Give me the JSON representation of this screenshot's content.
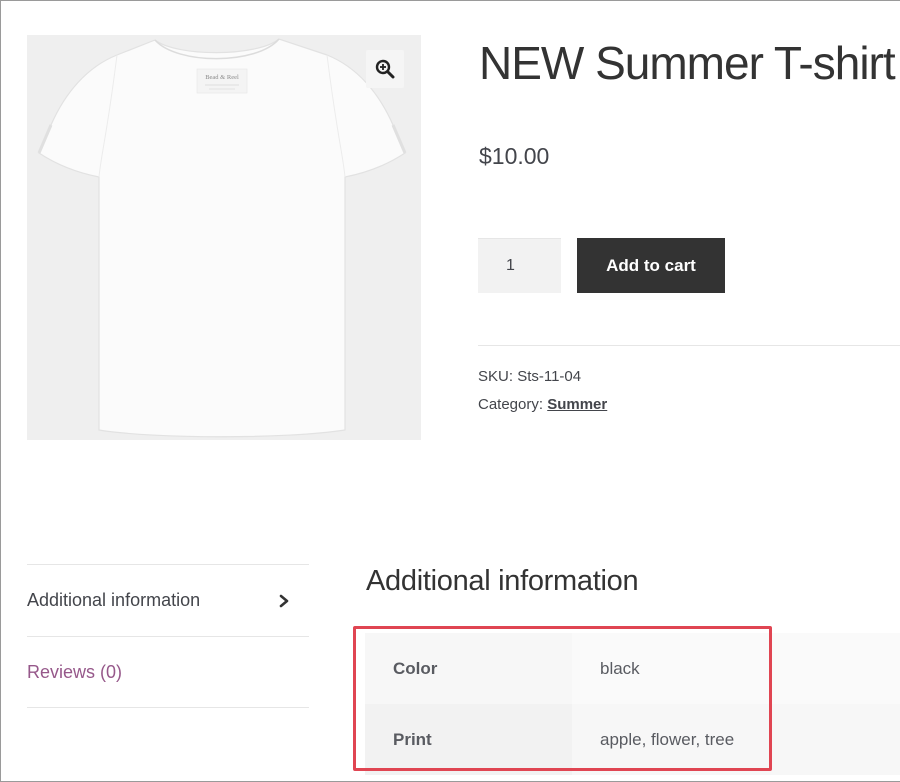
{
  "product": {
    "title": "NEW Summer T-shirt",
    "price": "$10.00",
    "image_brand_label": "Bead & Reel",
    "quantity": "1",
    "add_to_cart_label": "Add to cart",
    "sku_label": "SKU:",
    "sku": "Sts-11-04",
    "category_label": "Category:",
    "category": "Summer"
  },
  "tabs": [
    {
      "label": "Additional information",
      "active": true
    },
    {
      "label": "Reviews (0)",
      "active": false
    }
  ],
  "panel": {
    "heading": "Additional information",
    "attributes": [
      {
        "name": "Color",
        "value": "black"
      },
      {
        "name": "Print",
        "value": "apple, flower, tree"
      }
    ]
  },
  "icons": {
    "zoom": "zoom-in-icon",
    "tab_chevron": "chevron-right-icon"
  },
  "colors": {
    "button_bg": "#333333",
    "link_purple": "#96588a",
    "highlight_red": "#e04552"
  }
}
